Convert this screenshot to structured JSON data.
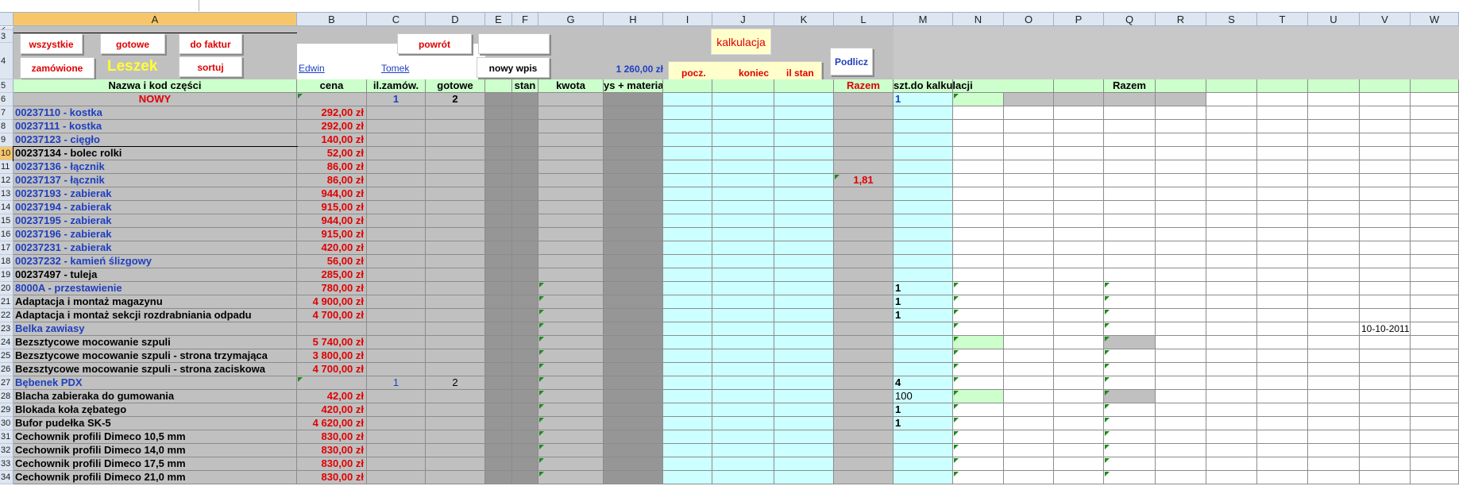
{
  "columns": [
    "A",
    "B",
    "C",
    "D",
    "E",
    "F",
    "G",
    "H",
    "I",
    "J",
    "K",
    "L",
    "M",
    "N",
    "O",
    "P",
    "Q",
    "R",
    "S",
    "T",
    "U",
    "V",
    "W"
  ],
  "buttons": {
    "wszystkie": "wszystkie",
    "gotowe": "gotowe",
    "do_faktur": "do faktur",
    "powrot": "powrót",
    "kalkulacja": "kalkulacja",
    "zamowione": "zamówione",
    "sortuj": "sortuj",
    "nowy_wpis": "nowy wpis",
    "pocz": "pocz.",
    "koniec": "koniec",
    "il_stan": "il stan",
    "podlicz": "Podlicz"
  },
  "user_label": "Leszek",
  "links": {
    "edwin": "Edwin",
    "tomek": "Tomek"
  },
  "total_value": "1 260,00 zł",
  "headers": {
    "A": "Nazwa i kod części",
    "B": "cena",
    "C": "il.zamów.",
    "D": "gotowe",
    "F": "stan",
    "G": "kwota",
    "H": "ys + materiał",
    "L": "Razem",
    "M": "szt.do kalkulacji",
    "Q": "Razem"
  },
  "row6": {
    "name": "NOWY",
    "C": "1",
    "D": "2",
    "M": "1"
  },
  "rows": [
    {
      "num": "7",
      "name": "00237110  -  kostka",
      "price": "292,00 zł",
      "blue": true
    },
    {
      "num": "8",
      "name": "00237111  -  kostka",
      "price": "292,00 zł",
      "blue": true
    },
    {
      "num": "9",
      "name": "00237123  -  cięgło",
      "price": "140,00 zł",
      "blue": true
    },
    {
      "num": "10",
      "name": "00237134  -  bolec rolki",
      "price": "52,00 zł",
      "blue": false
    },
    {
      "num": "11",
      "name": "00237136  -  łącznik",
      "price": "86,00 zł",
      "blue": true
    },
    {
      "num": "12",
      "name": "00237137  -  łącznik",
      "price": "86,00 zł",
      "blue": true,
      "L": "1,81"
    },
    {
      "num": "13",
      "name": "00237193  -  zabierak",
      "price": "944,00 zł",
      "blue": true
    },
    {
      "num": "14",
      "name": "00237194  -  zabierak",
      "price": "915,00 zł",
      "blue": true
    },
    {
      "num": "15",
      "name": "00237195  -  zabierak",
      "price": "944,00 zł",
      "blue": true
    },
    {
      "num": "16",
      "name": "00237196  -  zabierak",
      "price": "915,00 zł",
      "blue": true
    },
    {
      "num": "17",
      "name": "00237231  -  zabierak",
      "price": "420,00 zł",
      "blue": true
    },
    {
      "num": "18",
      "name": "00237232  -  kamień ślizgowy",
      "price": "56,00 zł",
      "blue": true
    },
    {
      "num": "19",
      "name": "00237497  -  tuleja",
      "price": "285,00 zł",
      "blue": false
    },
    {
      "num": "20",
      "name": "8000A - przestawienie",
      "price": "780,00 zł",
      "blue": true,
      "M": "1"
    },
    {
      "num": "21",
      "name": "Adaptacja i montaż magazynu",
      "price": "4 900,00 zł",
      "blue": false,
      "M": "1"
    },
    {
      "num": "22",
      "name": "Adaptacja i montaż sekcji rozdrabniania odpadu",
      "price": "4 700,00 zł",
      "blue": false,
      "M": "1"
    },
    {
      "num": "23",
      "name": "Belka zawiasy",
      "price": "",
      "blue": true,
      "V": "10-10-2011"
    },
    {
      "num": "24",
      "name": "Bezsztycowe mocowanie szpuli",
      "price": "5 740,00 zł",
      "blue": false
    },
    {
      "num": "25",
      "name": "Bezsztycowe mocowanie szpuli - strona trzymająca",
      "price": "3 800,00 zł",
      "blue": false
    },
    {
      "num": "26",
      "name": "Bezsztycowe mocowanie szpuli - strona zaciskowa",
      "price": "4 700,00 zł",
      "blue": false
    },
    {
      "num": "27",
      "name": "Bębenek PDX",
      "price": "",
      "blue": true,
      "C": "1",
      "D": "2",
      "M": "4"
    },
    {
      "num": "28",
      "name": "Blacha zabieraka do gumowania",
      "price": "42,00 zł",
      "blue": false,
      "M": "100"
    },
    {
      "num": "29",
      "name": "Blokada koła zębatego",
      "price": "420,00 zł",
      "blue": false,
      "M": "1"
    },
    {
      "num": "30",
      "name": "Bufor pudełka SK-5",
      "price": "4 620,00 zł",
      "blue": false,
      "M": "1"
    },
    {
      "num": "31",
      "name": "Cechownik profili Dimeco  10,5 mm",
      "price": "830,00 zł",
      "blue": false
    },
    {
      "num": "32",
      "name": "Cechownik profili Dimeco  14,0 mm",
      "price": "830,00 zł",
      "blue": false
    },
    {
      "num": "33",
      "name": "Cechownik profili Dimeco  17,5 mm",
      "price": "830,00 zł",
      "blue": false
    },
    {
      "num": "34",
      "name": "Cechownik profili Dimeco  21,0 mm",
      "price": "830,00 zł",
      "blue": false
    }
  ],
  "colors": {
    "gray": "#c0c0c0",
    "darkgray": "#969696",
    "cyan": "#ccffff",
    "lightgreen": "#ccffcc",
    "header_fill": "#ccffcc",
    "red": "#e00000",
    "blue": "#1f3fbf",
    "yellow": "#ffff33"
  }
}
